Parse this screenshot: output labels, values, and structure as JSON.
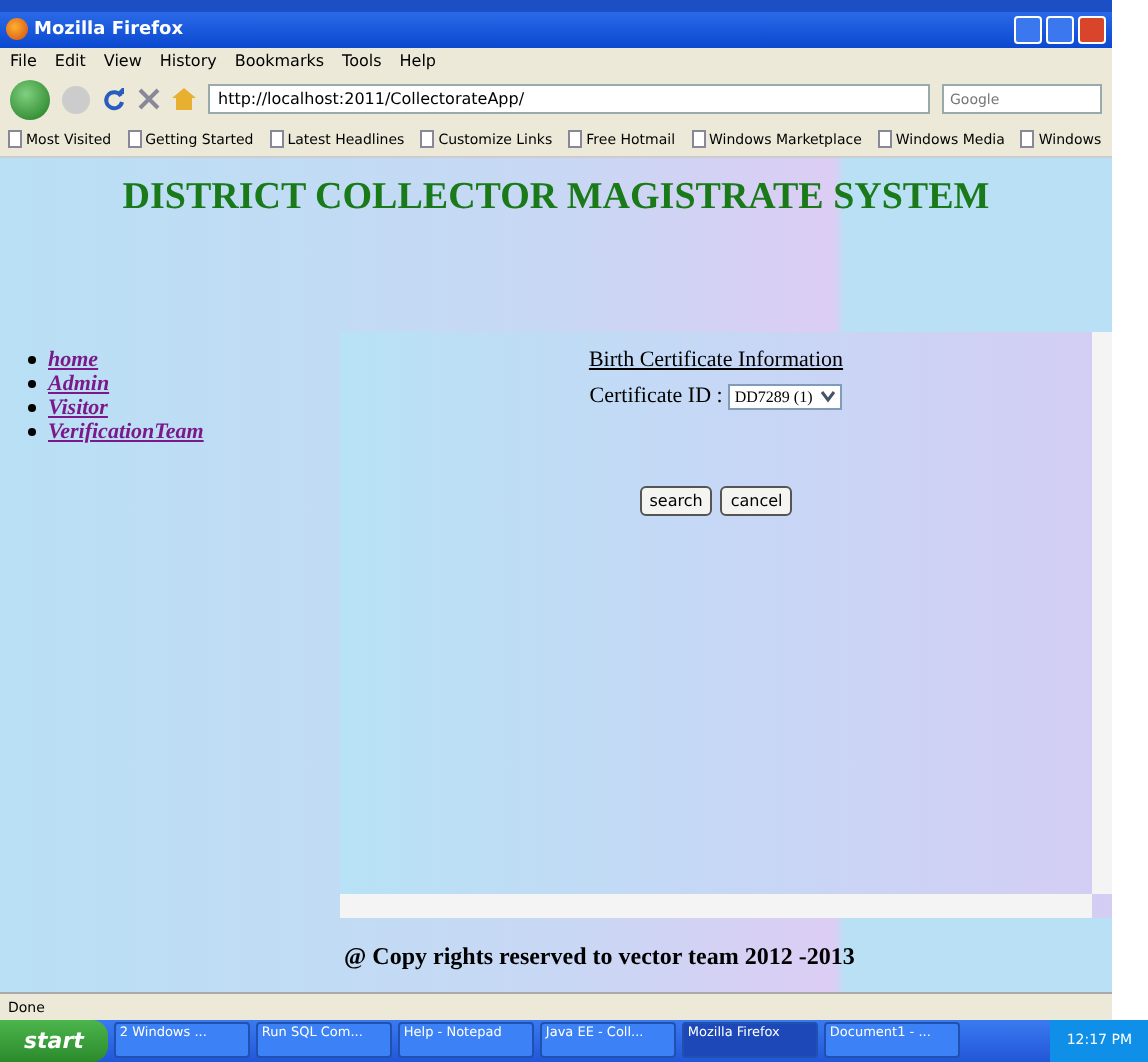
{
  "window": {
    "title": "Mozilla Firefox"
  },
  "menu": [
    "File",
    "Edit",
    "View",
    "History",
    "Bookmarks",
    "Tools",
    "Help"
  ],
  "address": {
    "value": "http://localhost:2011/CollectorateApp/"
  },
  "search": {
    "placeholder": "Google"
  },
  "bookmarks": [
    "Most Visited",
    "Getting Started",
    "Latest Headlines",
    "Customize Links",
    "Free Hotmail",
    "Windows Marketplace",
    "Windows Media",
    "Windows"
  ],
  "page": {
    "title": "DISTRICT COLLECTOR MAGISTRATE SYSTEM",
    "nav": [
      "home",
      "Admin",
      "Visitor",
      "VerificationTeam"
    ],
    "form": {
      "heading": "Birth Certificate Information",
      "label": "Certificate ID :",
      "value": "DD7289 (1)",
      "buttons": [
        "search",
        "cancel"
      ]
    },
    "footer": "@ Copy rights reserved to vector team 2012 -2013"
  },
  "status_bar": "Done",
  "taskbar": {
    "start": "start",
    "items": [
      {
        "label": "2 Windows ...",
        "selected": false
      },
      {
        "label": "Run SQL Com...",
        "selected": false
      },
      {
        "label": "Help - Notepad",
        "selected": false
      },
      {
        "label": "Java EE - Coll...",
        "selected": false
      },
      {
        "label": "Mozilla Firefox",
        "selected": true
      },
      {
        "label": "Document1 - ...",
        "selected": false
      }
    ],
    "clock": "12:17 PM"
  }
}
